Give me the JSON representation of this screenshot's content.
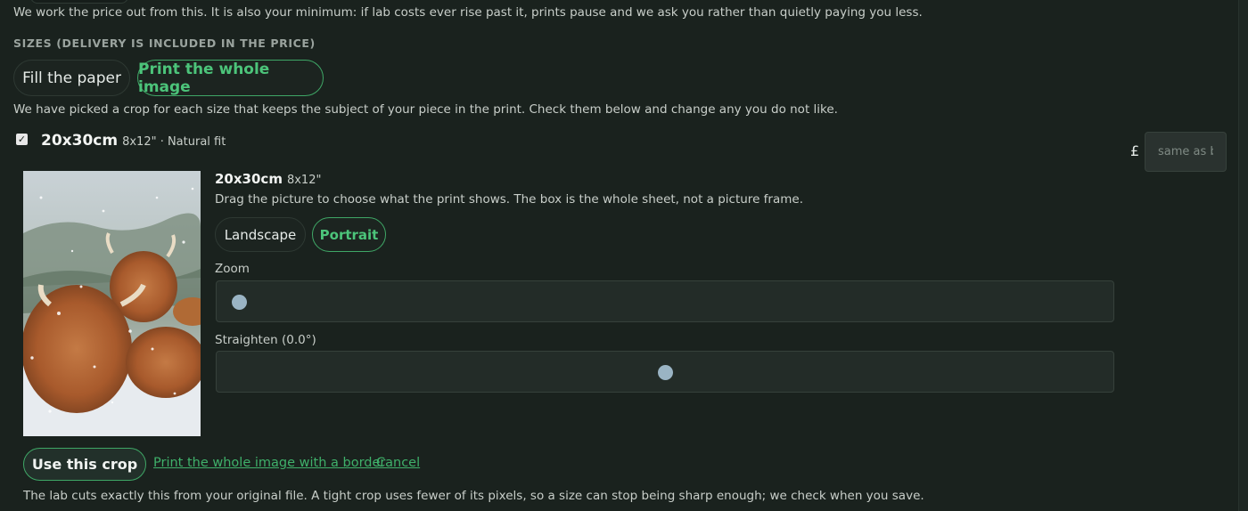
{
  "intro": {
    "text": "We work the price out from this. It is also your minimum: if lab costs ever rise past it, prints pause and we ask you rather than quietly paying you less."
  },
  "sizes": {
    "heading": "SIZES (DELIVERY IS INCLUDED IN THE PRICE)",
    "modes": [
      {
        "label": "Fill the paper",
        "active": false
      },
      {
        "label": "Print the whole image",
        "active": true
      }
    ],
    "picked_note": "We have picked a crop for each size that keeps the subject of your piece in the print. Check them below and change any you do not like."
  },
  "size_item": {
    "checked": true,
    "name": "20x30cm",
    "sub": "8x12\" · Natural fit",
    "currency": "£",
    "price_placeholder": "same as base"
  },
  "crop_editor": {
    "title": "20x30cm",
    "title_sub": "8x12\"",
    "drag_note": "Drag the picture to choose what the print shows. The box is the whole sheet, not a picture frame.",
    "orientations": [
      {
        "label": "Landscape",
        "active": false
      },
      {
        "label": "Portrait",
        "active": true
      }
    ],
    "zoom_label": "Zoom",
    "zoom_value": 0,
    "straighten_label": "Straighten (0.0°)",
    "straighten_value": 0.5,
    "use_crop_label": "Use this crop",
    "border_link": "Print the whole image with a border",
    "cancel_link": "Cancel",
    "footer_note": "The lab cuts exactly this from your original file. A tight crop uses fewer of its pixels, so a size can stop being sharp enough; we check when you save."
  },
  "colors": {
    "background": "#1a221e",
    "accent_green": "#3fa766",
    "slider_thumb": "#9ab4c4"
  }
}
